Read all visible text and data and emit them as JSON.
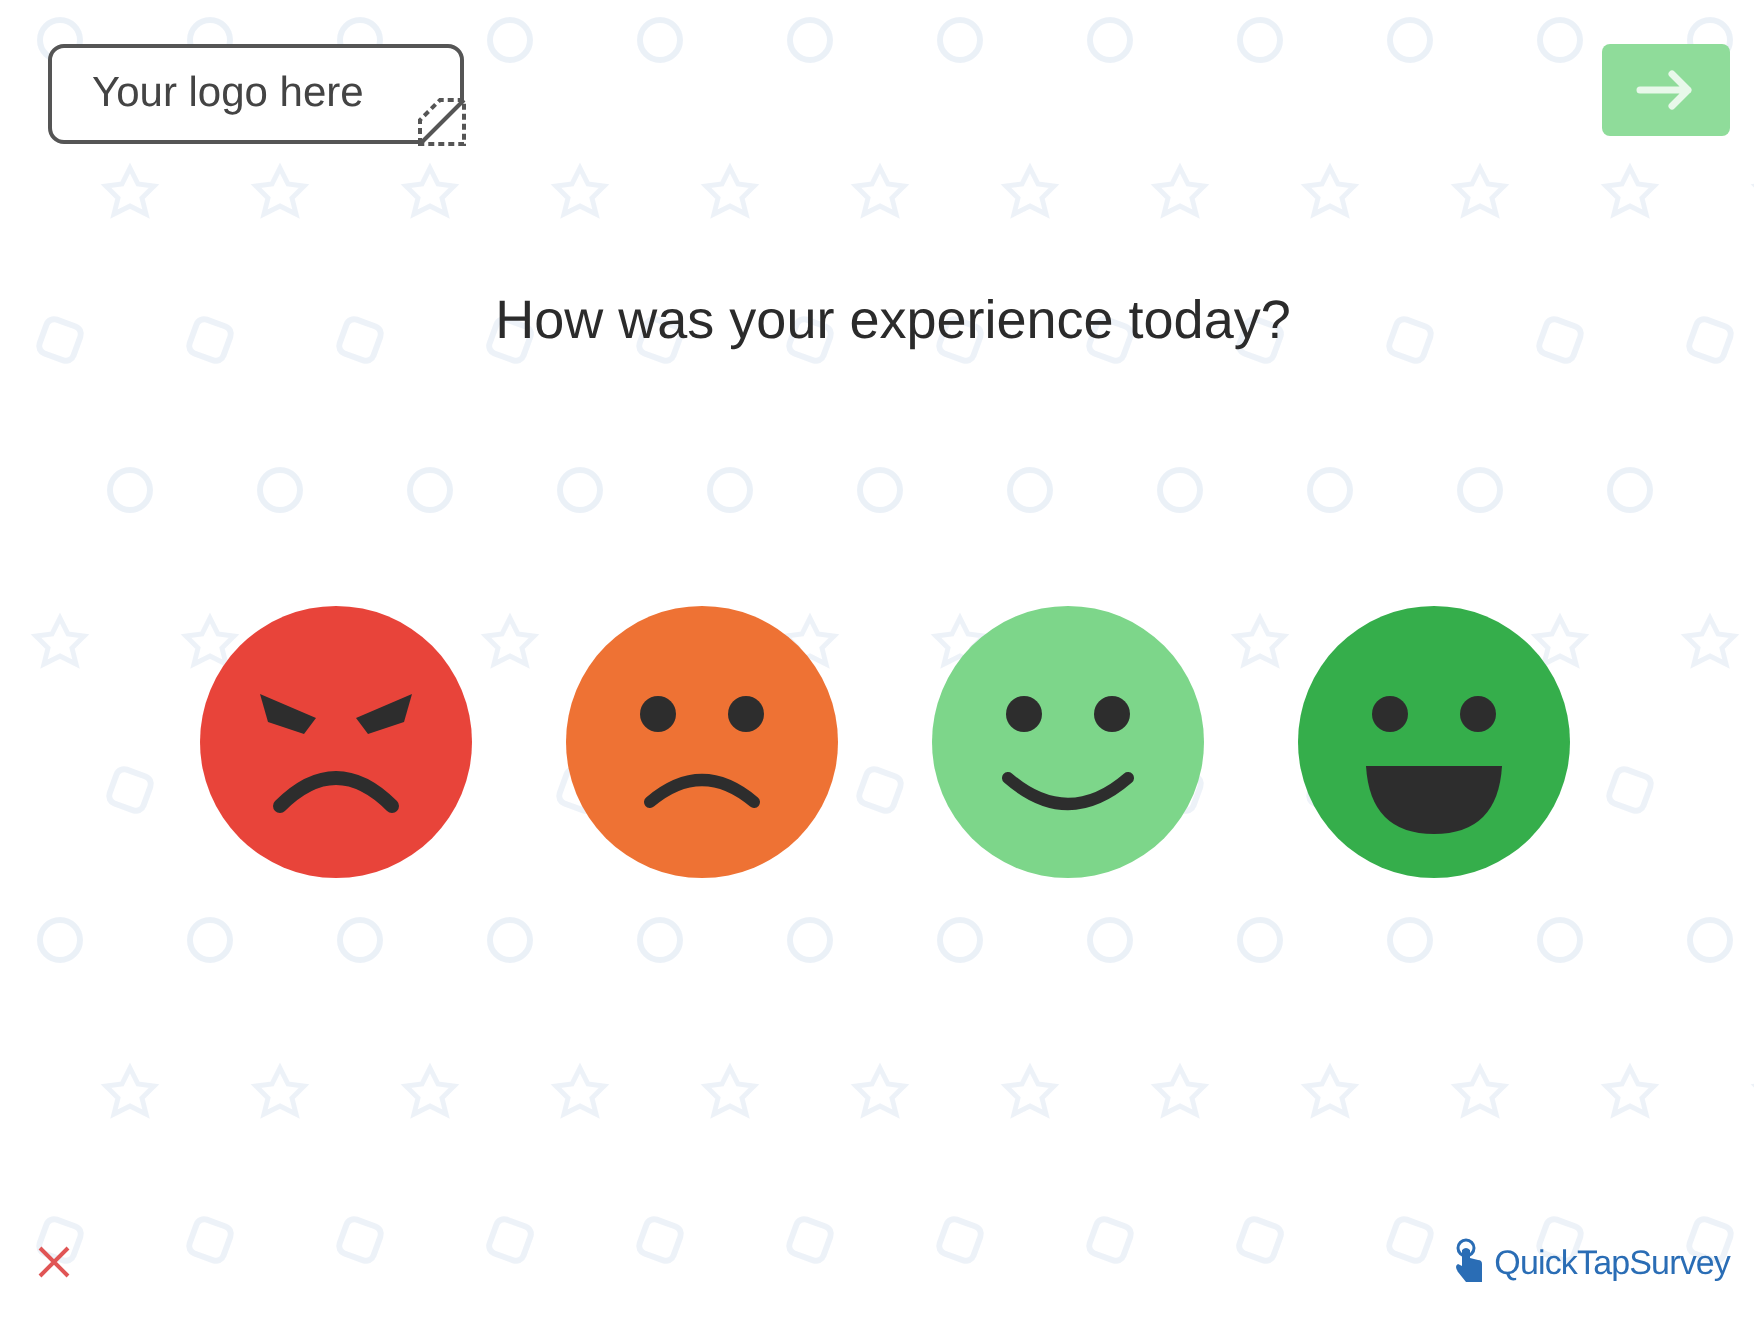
{
  "header": {
    "logo_text": "Your logo here"
  },
  "question": "How was your experience today?",
  "faces": [
    {
      "kind": "angry",
      "color": "#e8443a"
    },
    {
      "kind": "sad",
      "color": "#ee7234"
    },
    {
      "kind": "smile",
      "color": "#7dd68a"
    },
    {
      "kind": "grin",
      "color": "#35ae4b"
    }
  ],
  "footer": {
    "brand": "QuickTapSurvey"
  }
}
